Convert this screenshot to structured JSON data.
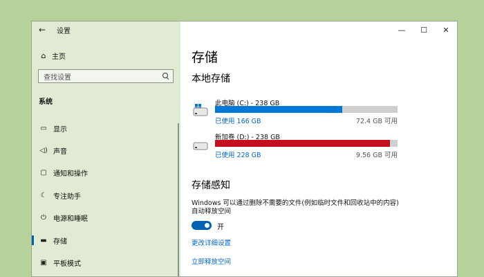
{
  "window": {
    "title": "设置",
    "back_icon": "back-arrow-icon",
    "controls": {
      "minimize": "—",
      "maximize": "☐",
      "close": "✕"
    }
  },
  "sidebar": {
    "home": {
      "label": "主页",
      "icon": "home-icon"
    },
    "search": {
      "placeholder": "查找设置",
      "icon": "search-icon"
    },
    "section_title": "系统",
    "items": [
      {
        "label": "显示",
        "icon": "display-icon",
        "glyph": "▭"
      },
      {
        "label": "声音",
        "icon": "speaker-icon",
        "glyph": "◁)"
      },
      {
        "label": "通知和操作",
        "icon": "notification-icon",
        "glyph": "▢"
      },
      {
        "label": "专注助手",
        "icon": "moon-icon",
        "glyph": "☾"
      },
      {
        "label": "电源和睡眠",
        "icon": "power-icon",
        "glyph": "⏻"
      },
      {
        "label": "存储",
        "icon": "storage-icon",
        "glyph": "▬",
        "active": true
      },
      {
        "label": "平板模式",
        "icon": "tablet-icon",
        "glyph": "▣"
      }
    ]
  },
  "main": {
    "page_title": "存储",
    "local_storage_title": "本地存储",
    "drives": [
      {
        "name": "此电脑 (C:) - 238 GB",
        "used": "已使用 166 GB",
        "free": "72.4 GB 可用",
        "used_fraction": 0.697,
        "bar_color": "#0078d7",
        "icon": "windows-drive-icon"
      },
      {
        "name": "新加卷 (D:) - 238 GB",
        "used": "已使用 228 GB",
        "free": "9.56 GB 可用",
        "used_fraction": 0.96,
        "bar_color": "#c50f1f",
        "icon": "drive-icon"
      }
    ],
    "storage_sense": {
      "title": "存储感知",
      "description": "Windows 可以通过删除不需要的文件(例如临时文件和回收站中的内容)自动释放空间",
      "toggle_state": "开",
      "toggle_on": true,
      "links": [
        "更改详细设置",
        "立即释放空间"
      ]
    }
  },
  "colors": {
    "accent": "#0063b1",
    "link": "#0066cc",
    "sidebar_bg": "#e1ead2",
    "desktop_bg": "#b6d29a"
  }
}
